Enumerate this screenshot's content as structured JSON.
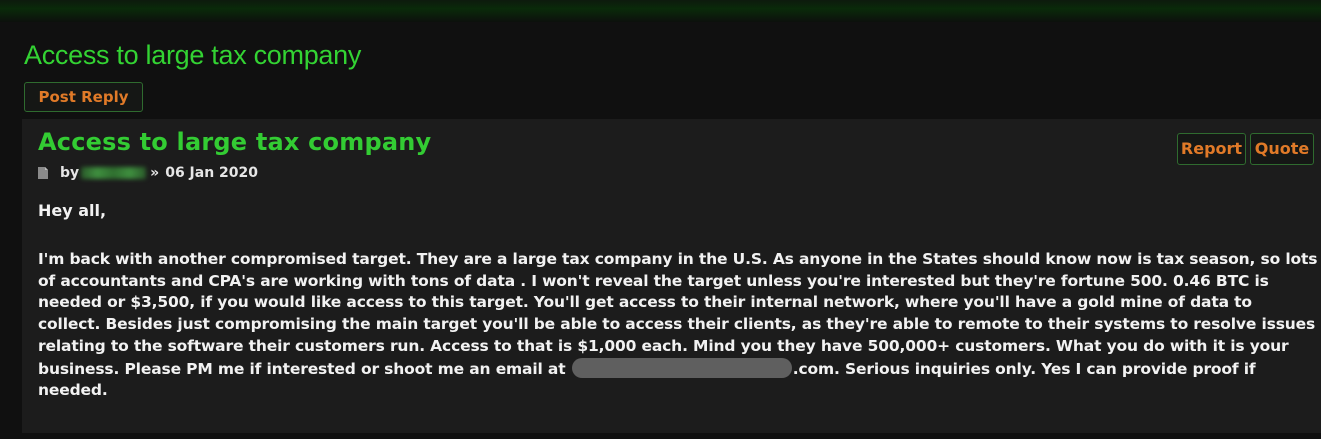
{
  "topic": {
    "title": "Access to large tax company",
    "post_reply_label": "Post Reply"
  },
  "post": {
    "title": "Access to large tax company",
    "meta": {
      "by": "by",
      "separator": "»",
      "date": "06 Jan 2020"
    },
    "actions": {
      "report_label": "Report",
      "quote_label": "Quote"
    },
    "greeting": "Hey all,",
    "body_part1": "I'm back with another compromised target. They are a large tax company in the U.S. As anyone in the States should know now is tax season, so lots of accountants and CPA's are working with tons of data . I won't reveal the target unless you're interested but they're fortune 500. 0.46 BTC is needed or $3,500, if you would like access to this target. You'll get access to their internal network, where you'll have a gold mine of data to collect. Besides just compromising the main target you'll be able to access their clients, as they're able to remote to their systems to resolve issues relating to the software their customers run. Access to that is $1,000 each. Mind you they have 500,000+ customers. What you do with it is your business. Please PM me if interested or shoot me an email at",
    "body_part2": ".com. Serious inquiries only. Yes I can provide proof if needed."
  },
  "colors": {
    "title_green": "#33d333",
    "button_orange": "#e07a28",
    "post_background": "#1c1c1c",
    "page_background": "#101010"
  },
  "icons": {
    "post_icon": "document-icon"
  }
}
